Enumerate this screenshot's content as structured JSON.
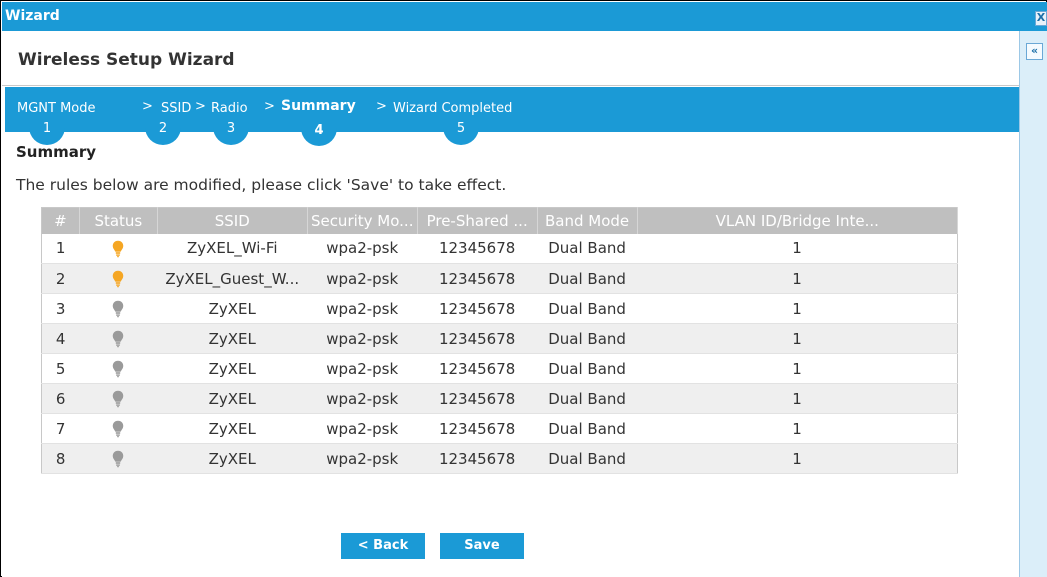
{
  "window": {
    "title": "Wizard",
    "close_glyph": "X"
  },
  "header": {
    "title": "Wireless Setup Wizard"
  },
  "steps": [
    {
      "label": "MGNT Mode",
      "number": "1",
      "active": false
    },
    {
      "label": "SSID",
      "number": "2",
      "active": false
    },
    {
      "label": "Radio",
      "number": "3",
      "active": false
    },
    {
      "label": "Summary",
      "number": "4",
      "active": true
    },
    {
      "label": "Wizard Completed",
      "number": "5",
      "active": false
    }
  ],
  "step_separator": ">",
  "summary": {
    "title": "Summary",
    "notice": "The rules below are modified, please click 'Save' to take effect."
  },
  "table": {
    "columns": [
      "#",
      "Status",
      "SSID",
      "Security Mo...",
      "Pre-Shared ...",
      "Band Mode",
      "VLAN ID/Bridge Inte..."
    ],
    "rows": [
      {
        "num": "1",
        "status": "on",
        "ssid": "ZyXEL_Wi-Fi",
        "security": "wpa2-psk",
        "psk": "12345678",
        "band": "Dual Band",
        "vlan": "1"
      },
      {
        "num": "2",
        "status": "on",
        "ssid": "ZyXEL_Guest_W...",
        "security": "wpa2-psk",
        "psk": "12345678",
        "band": "Dual Band",
        "vlan": "1"
      },
      {
        "num": "3",
        "status": "off",
        "ssid": "ZyXEL",
        "security": "wpa2-psk",
        "psk": "12345678",
        "band": "Dual Band",
        "vlan": "1"
      },
      {
        "num": "4",
        "status": "off",
        "ssid": "ZyXEL",
        "security": "wpa2-psk",
        "psk": "12345678",
        "band": "Dual Band",
        "vlan": "1"
      },
      {
        "num": "5",
        "status": "off",
        "ssid": "ZyXEL",
        "security": "wpa2-psk",
        "psk": "12345678",
        "band": "Dual Band",
        "vlan": "1"
      },
      {
        "num": "6",
        "status": "off",
        "ssid": "ZyXEL",
        "security": "wpa2-psk",
        "psk": "12345678",
        "band": "Dual Band",
        "vlan": "1"
      },
      {
        "num": "7",
        "status": "off",
        "ssid": "ZyXEL",
        "security": "wpa2-psk",
        "psk": "12345678",
        "band": "Dual Band",
        "vlan": "1"
      },
      {
        "num": "8",
        "status": "off",
        "ssid": "ZyXEL",
        "security": "wpa2-psk",
        "psk": "12345678",
        "band": "Dual Band",
        "vlan": "1"
      }
    ]
  },
  "buttons": {
    "back": "< Back",
    "save": "Save"
  },
  "sidepanel": {
    "collapse_glyph": "«"
  },
  "colors": {
    "accent": "#1b9ad6",
    "bulb_on": "#f5a623",
    "bulb_off": "#9a9a9a",
    "header_gray": "#bfbfbf"
  },
  "icons": {
    "status_on": "lightbulb-on-icon",
    "status_off": "lightbulb-off-icon"
  }
}
